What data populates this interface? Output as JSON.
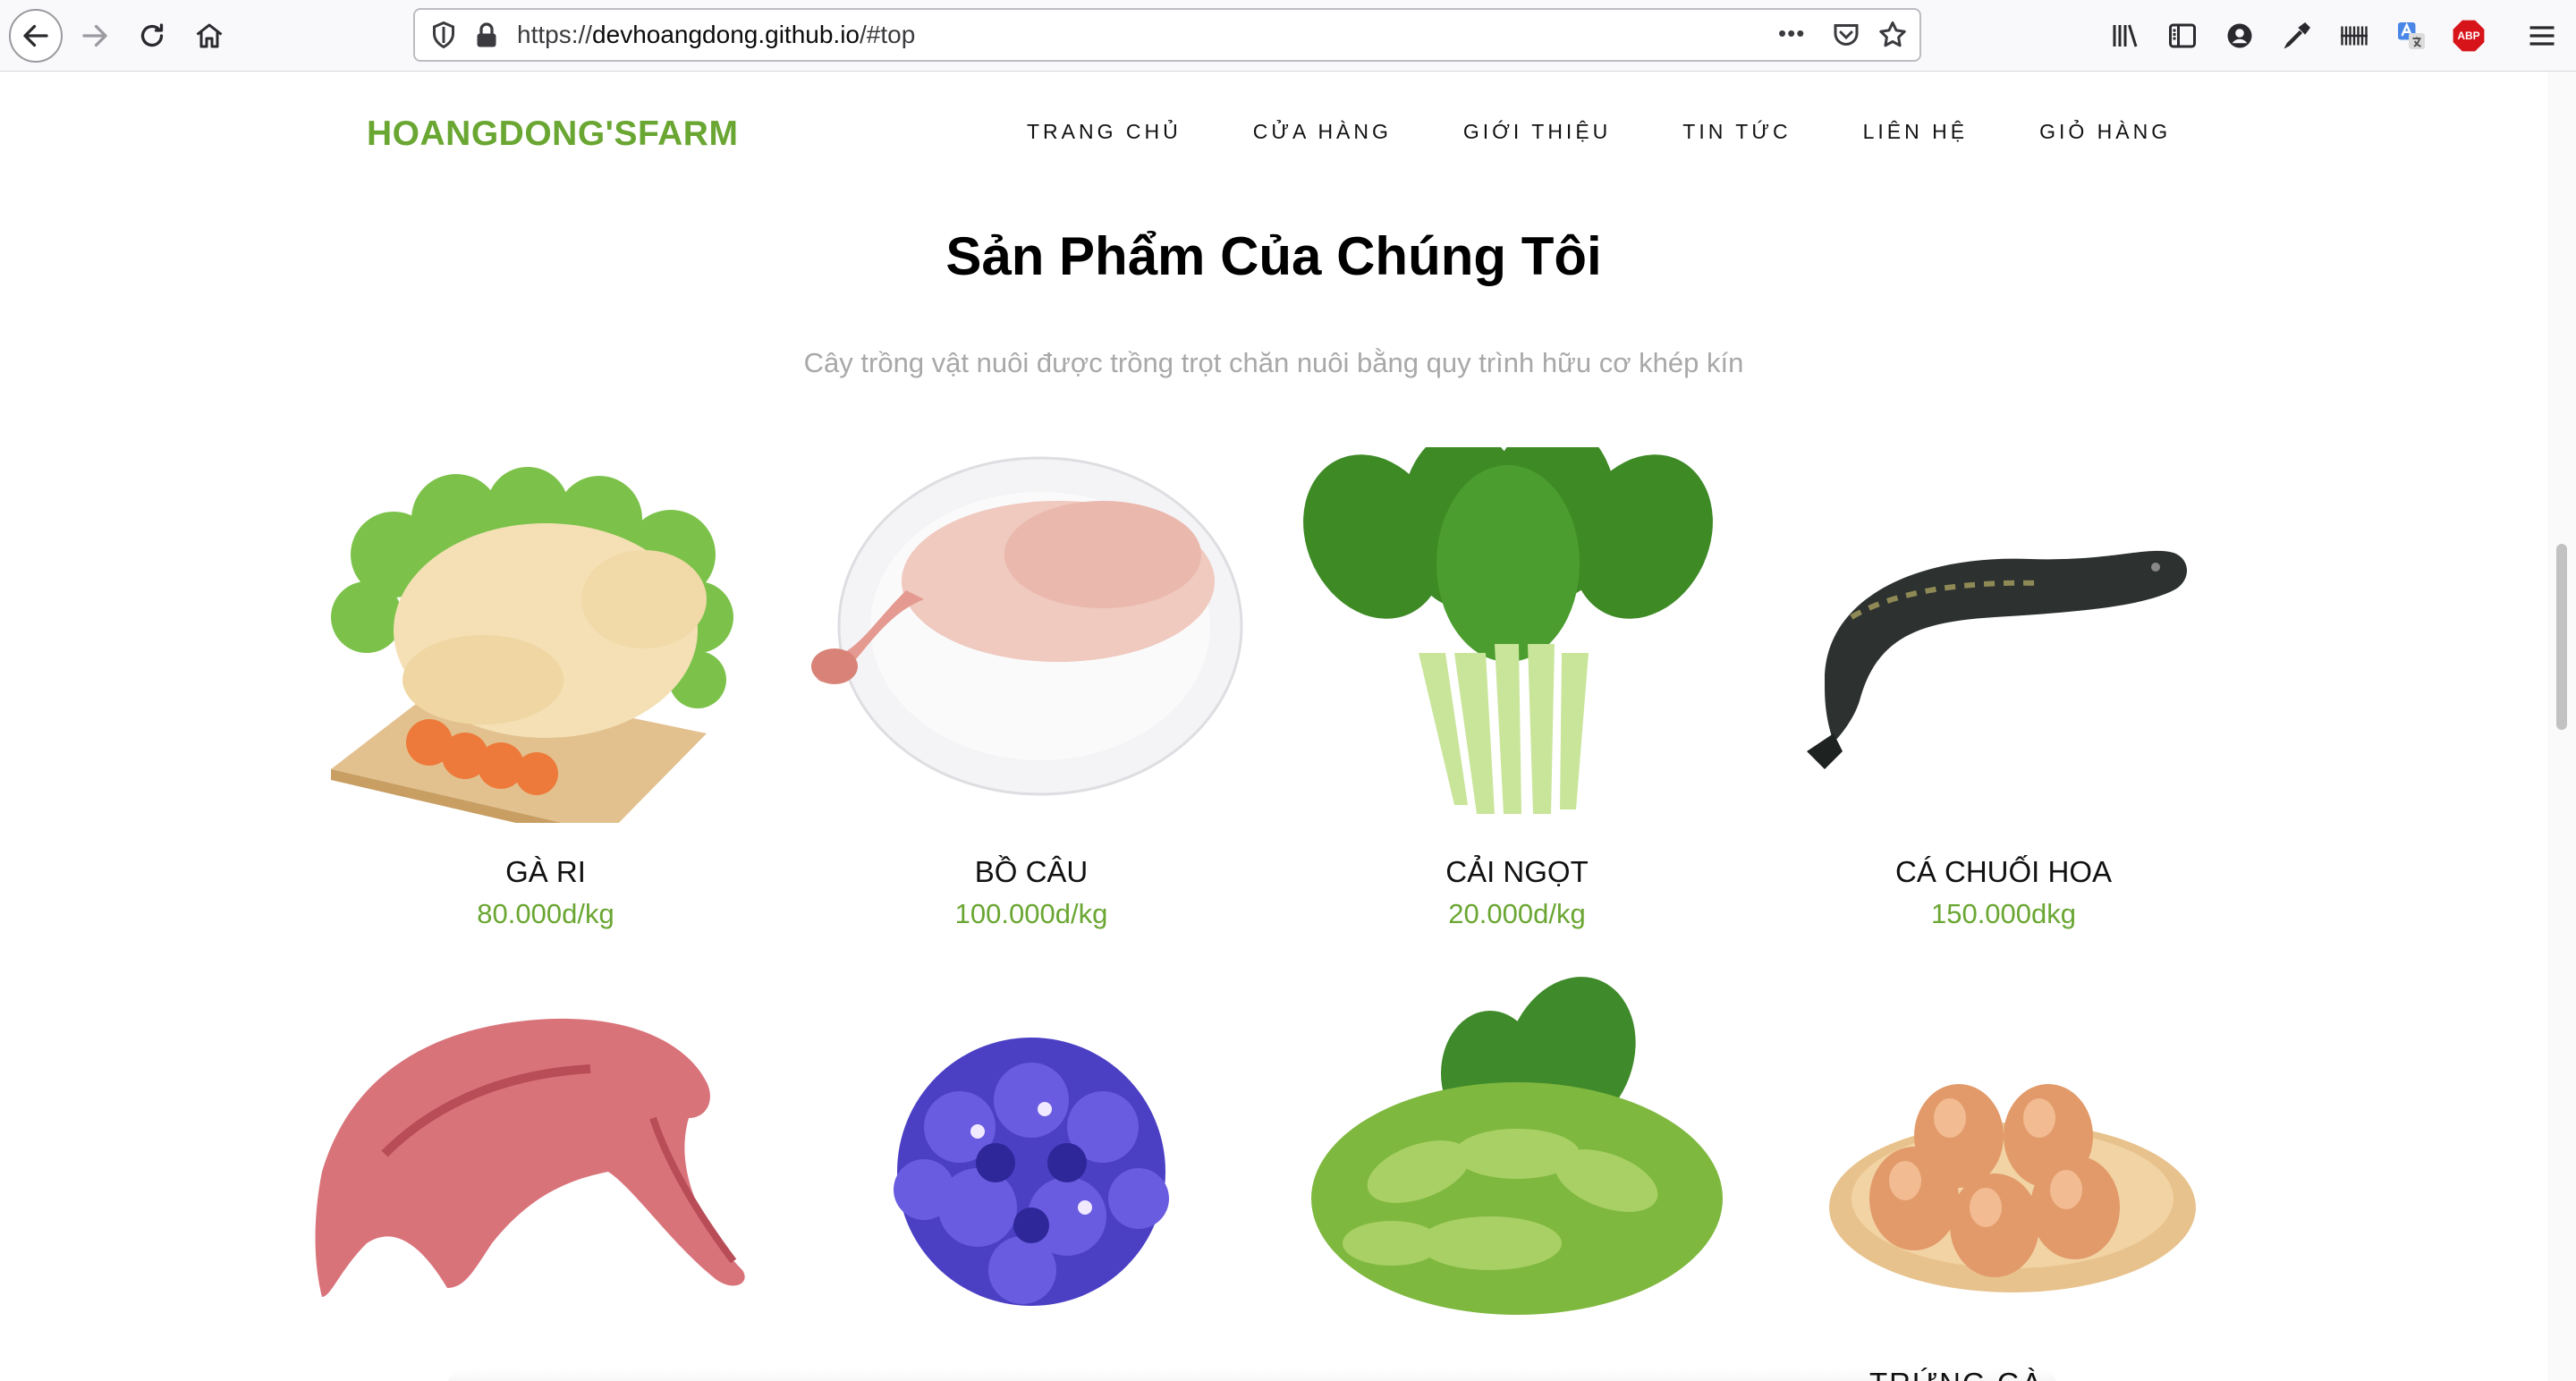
{
  "browser": {
    "url_prefix": "https://",
    "url_host": "devhoangdong.github.io",
    "url_suffix": "/#top",
    "more_label": "•••",
    "abp_label": "ABP"
  },
  "header": {
    "brand": "HOANGDONG'SFARM",
    "nav": [
      "TRANG CHỦ",
      "CỬA HÀNG",
      "GIỚI THIỆU",
      "TIN TỨC",
      "LIÊN HỆ",
      "GIỎ HÀNG"
    ]
  },
  "section": {
    "title": "Sản Phẩm Của Chúng Tôi",
    "subtitle": "Cây trồng vật nuôi được trồng trọt chăn nuôi bằng quy trình hữu cơ khép kín"
  },
  "products": [
    {
      "name": "GÀ RI",
      "price": "80.000d/kg"
    },
    {
      "name": "BỒ CÂU",
      "price": "100.000d/kg"
    },
    {
      "name": "CẢI NGỌT",
      "price": "20.000d/kg"
    },
    {
      "name": "CÁ CHUỐI HOA",
      "price": "150.000dkg"
    }
  ],
  "row2_partial_label": "TRỨNG GÀ ...",
  "colors": {
    "brand_green": "#6aa632",
    "text_dark": "#111111",
    "subtitle_gray": "#a8a8a8"
  },
  "icons": {
    "back": "arrow-left-icon",
    "forward": "arrow-right-icon",
    "reload": "reload-icon",
    "home": "home-icon",
    "shield": "shield-icon",
    "lock": "lock-icon",
    "pocket": "pocket-icon",
    "bookmark": "star-icon",
    "library": "library-icon",
    "sidebar": "sidebar-icon",
    "account": "account-icon",
    "eyedropper": "eyedropper-icon",
    "extension": "barcode-icon",
    "translate": "translate-icon",
    "adblock": "adblock-icon",
    "menu": "hamburger-menu-icon"
  }
}
